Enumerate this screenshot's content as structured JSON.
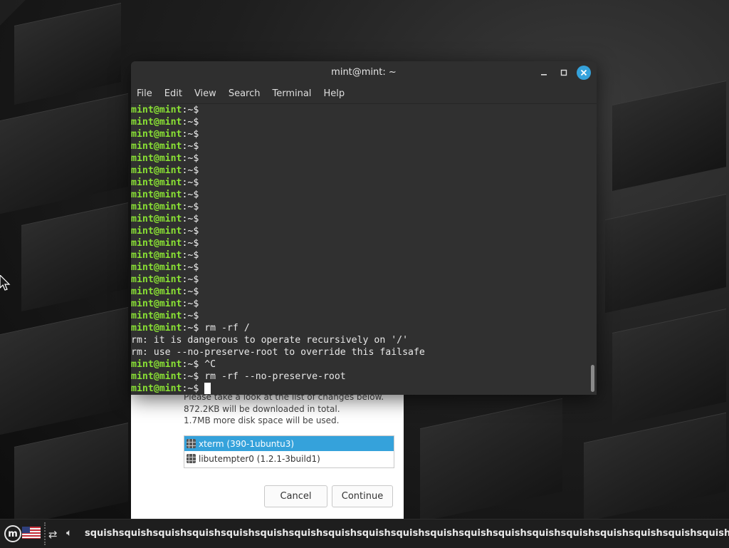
{
  "terminal": {
    "title": "mint@mint: ~",
    "menu": [
      "File",
      "Edit",
      "View",
      "Search",
      "Terminal",
      "Help"
    ],
    "prompt_user": "mint@mint",
    "prompt_path": ":~$",
    "lines": [
      {
        "type": "prompt",
        "cmd": ""
      },
      {
        "type": "prompt",
        "cmd": ""
      },
      {
        "type": "prompt",
        "cmd": ""
      },
      {
        "type": "prompt",
        "cmd": ""
      },
      {
        "type": "prompt",
        "cmd": ""
      },
      {
        "type": "prompt",
        "cmd": ""
      },
      {
        "type": "prompt",
        "cmd": ""
      },
      {
        "type": "prompt",
        "cmd": ""
      },
      {
        "type": "prompt",
        "cmd": ""
      },
      {
        "type": "prompt",
        "cmd": ""
      },
      {
        "type": "prompt",
        "cmd": ""
      },
      {
        "type": "prompt",
        "cmd": ""
      },
      {
        "type": "prompt",
        "cmd": ""
      },
      {
        "type": "prompt",
        "cmd": ""
      },
      {
        "type": "prompt",
        "cmd": ""
      },
      {
        "type": "prompt",
        "cmd": ""
      },
      {
        "type": "prompt",
        "cmd": ""
      },
      {
        "type": "prompt",
        "cmd": ""
      },
      {
        "type": "prompt",
        "cmd": " rm -rf /"
      },
      {
        "type": "output",
        "text": "rm: it is dangerous to operate recursively on '/'"
      },
      {
        "type": "output",
        "text": "rm: use --no-preserve-root to override this failsafe"
      },
      {
        "type": "prompt",
        "cmd": " ^C"
      },
      {
        "type": "prompt",
        "cmd": " rm -rf --no-preserve-root"
      },
      {
        "type": "prompt",
        "cmd": " ",
        "cursor": true
      }
    ]
  },
  "dialog": {
    "line1": "Please take a look at the list of changes below.",
    "line2": "872.2KB will be downloaded in total.",
    "line3": "1.7MB more disk space will be used.",
    "packages": [
      {
        "label": "xterm (390-1ubuntu3)",
        "selected": true
      },
      {
        "label": "libutempter0 (1.2.1-3build1)",
        "selected": false
      }
    ],
    "cancel_label": "Cancel",
    "continue_label": "Continue"
  },
  "panel": {
    "menu_icon": "mint-logo-icon",
    "keyboard_layout": "us-flag-icon",
    "network_icon": "network-disconnected-icon",
    "volume_icon": "volume-icon",
    "window_text": "squishsquishsquishsquishsquishsquishsquishsquishsquishsquishsquishsquishsquishsquishsquishsquishsquishsquishsquishsquishsquishsquish"
  },
  "colors": {
    "prompt_green": "#8ae234",
    "accent_blue": "#35a2db",
    "terminal_bg": "#303030"
  }
}
